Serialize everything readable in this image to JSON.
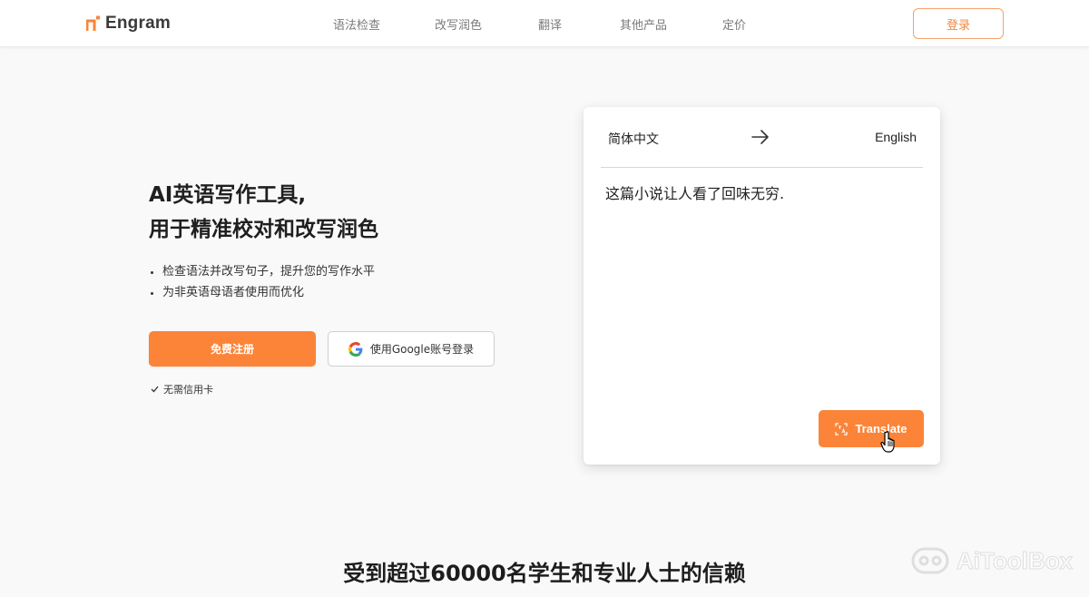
{
  "brand": {
    "name": "Engram",
    "accent": "#fb8439"
  },
  "nav": {
    "items": [
      "语法检查",
      "改写润色",
      "翻译",
      "其他产品",
      "定价"
    ],
    "login_label": "登录"
  },
  "hero": {
    "title_line1": "AI英语写作工具,",
    "title_line2": "用于精准校对和改写润色",
    "bullets": [
      "检查语法并改写句子，提升您的写作水平",
      "为非英语母语者使用而优化"
    ],
    "signup_label": "免费注册",
    "google_label": "使用Google账号登录",
    "no_card_label": "无需信用卡"
  },
  "translator": {
    "source_lang": "简体中文",
    "target_lang": "English",
    "source_text": "这篇小说让人看了回味无穷.",
    "translate_label": "Translate"
  },
  "trust": {
    "title": "受到超过60000名学生和专业人士的信赖"
  },
  "watermark": {
    "text": "AiToolBox"
  }
}
